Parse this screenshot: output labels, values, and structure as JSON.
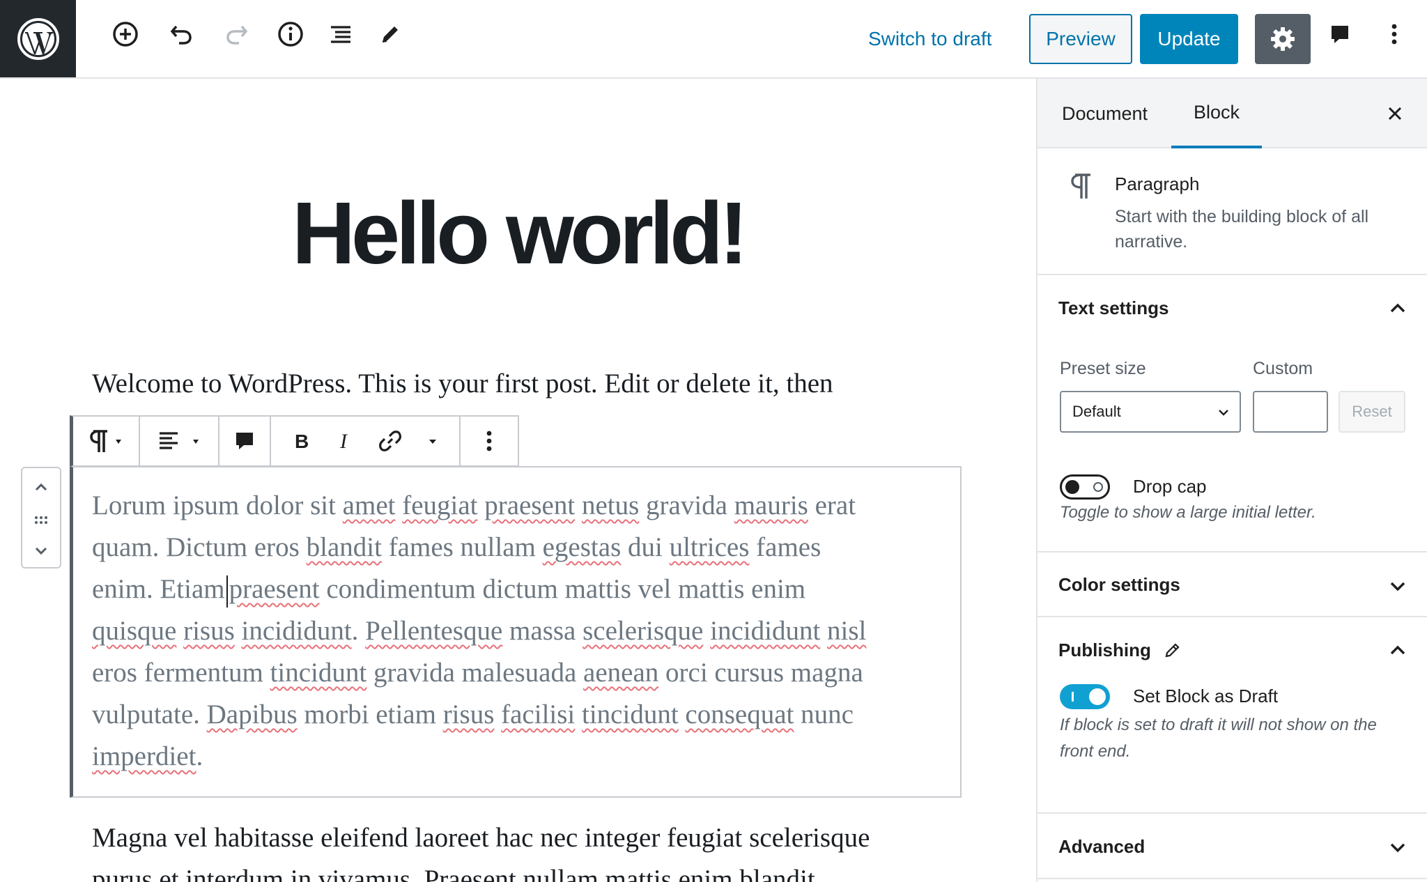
{
  "toolbar": {
    "switch_to_draft": "Switch to draft",
    "preview": "Preview",
    "update": "Update"
  },
  "editor": {
    "title": "Hello world!",
    "para_top": "Welcome to WordPress. This is your first post. Edit or delete it, then",
    "selected_paragraph": [
      [
        "Lorum ipsum dolor sit ",
        {
          "s": "amet"
        },
        " ",
        {
          "s": "feugiat"
        },
        " ",
        {
          "s": "praesent"
        },
        " ",
        {
          "s": "netus"
        },
        " gravida ",
        {
          "s": "mauris"
        },
        " erat"
      ],
      [
        "quam. Dictum eros ",
        {
          "s": "blandit"
        },
        " fames nullam ",
        {
          "s": "egestas"
        },
        " dui ",
        {
          "s": "ultrices"
        },
        " fames"
      ],
      [
        "enim. Etiam",
        {
          "c": 1
        },
        {
          "s": "praesent"
        },
        " condimentum dictum mattis vel mattis enim"
      ],
      [
        {
          "s": "quisque"
        },
        " ",
        {
          "s": "risus"
        },
        " ",
        {
          "s": "incididunt"
        },
        ". ",
        {
          "s": "Pellentesque"
        },
        " massa ",
        {
          "s": "scelerisque"
        },
        " ",
        {
          "s": "incididunt"
        },
        " ",
        {
          "s": "nisl"
        }
      ],
      [
        "eros fermentum ",
        {
          "s": "tincidunt"
        },
        " gravida malesuada ",
        {
          "s": "aenean"
        },
        " orci cursus magna"
      ],
      [
        "vulputate. ",
        {
          "s": "Dapibus"
        },
        " morbi etiam ",
        {
          "s": "risus"
        },
        " ",
        {
          "s": "facilisi"
        },
        " ",
        {
          "s": "tincidunt"
        },
        " ",
        {
          "s": "consequat"
        },
        " nunc"
      ],
      [
        {
          "s": "imperdiet"
        },
        "."
      ]
    ],
    "para_bottom_1": "Magna vel habitasse eleifend laoreet hac nec integer feugiat scelerisque",
    "para_bottom_2": "purus et interdum in vivamus. Praesent nullam mattis enim blandit"
  },
  "sidebar": {
    "tabs": [
      "Document",
      "Block"
    ],
    "active_tab": "Block",
    "block": {
      "name": "Paragraph",
      "description": "Start with the building block of all narrative."
    },
    "text_settings": {
      "title": "Text settings",
      "preset_label": "Preset size",
      "custom_label": "Custom",
      "preset_value": "Default",
      "reset": "Reset",
      "drop_cap_label": "Drop cap",
      "drop_cap_help": "Toggle to show a large initial letter."
    },
    "color_settings": {
      "title": "Color settings"
    },
    "publishing": {
      "title": "Publishing",
      "toggle_label": "Set Block as Draft",
      "help": "If block is set to draft it will not show on the front end."
    },
    "advanced": {
      "title": "Advanced"
    }
  },
  "colors": {
    "accent": "#0073aa",
    "update_bg": "#0085ba",
    "settings_bg": "#555d66",
    "logo_bg": "#23282d",
    "toggle_on": "#11a0d2",
    "spell_underline": "#e8717a"
  },
  "icons": [
    "wordpress-logo-icon",
    "add-block-icon",
    "undo-icon",
    "redo-icon",
    "info-icon",
    "outline-icon",
    "tools-pencil-icon",
    "gear-icon",
    "comment-icon",
    "more-vertical-icon",
    "close-icon",
    "paragraph-icon",
    "align-left-icon",
    "bold-icon",
    "italic-icon",
    "link-icon",
    "chevron-up-icon",
    "chevron-down-icon",
    "drag-handle-icon",
    "pencil-icon"
  ]
}
